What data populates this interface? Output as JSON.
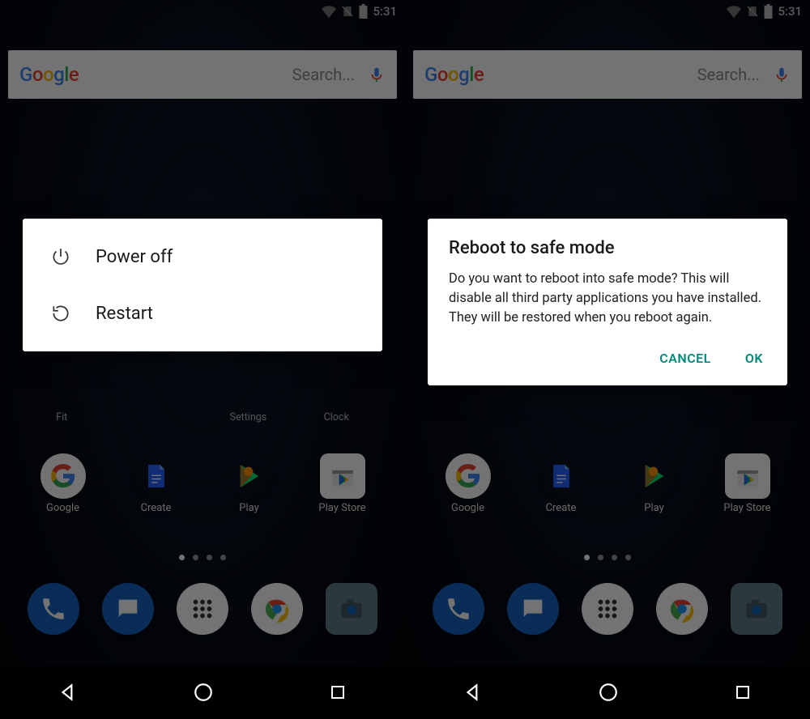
{
  "status": {
    "time": "5:31"
  },
  "search": {
    "placeholder": "Search..."
  },
  "powerMenu": {
    "powerOff": "Power off",
    "restart": "Restart"
  },
  "safeMode": {
    "title": "Reboot to safe mode",
    "body": "Do you want to reboot into safe mode? This will disable all third party applications you have installed. They will be restored when you reboot again.",
    "cancel": "CANCEL",
    "ok": "OK"
  },
  "appsRow1Labels": {
    "a": "Fit",
    "b": "Settings",
    "c": "Clock"
  },
  "appsRow2": {
    "google": "Google",
    "create": "Create",
    "play": "Play",
    "playStore": "Play Store"
  }
}
